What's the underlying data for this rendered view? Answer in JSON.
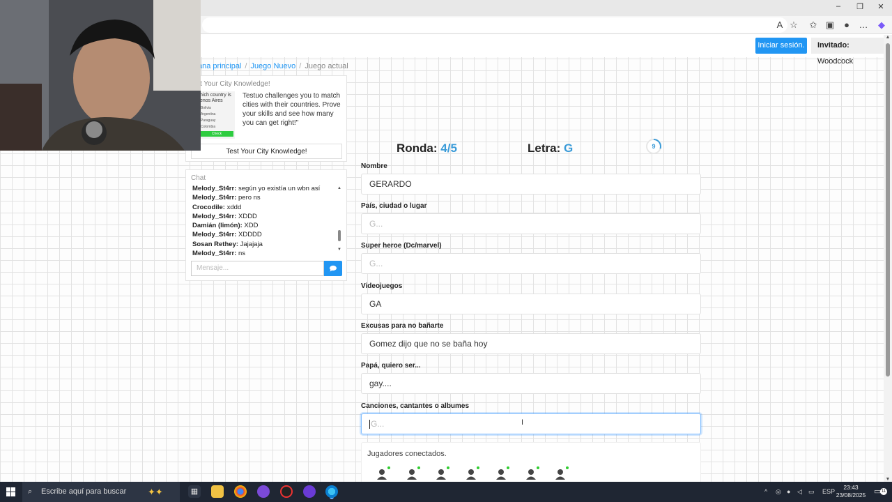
{
  "browser": {
    "window_buttons": {
      "minimize": "–",
      "restore": "❐",
      "close": "✕"
    },
    "toolbar_icons": [
      "read-aloud-icon",
      "favorite-star-icon",
      "favorites-icon",
      "collections-icon",
      "profile-icon",
      "more-icon",
      "copilot-icon"
    ]
  },
  "header": {
    "login_label": "Iniciar sesión.",
    "guest_prefix": "Invitado:",
    "guest_name": "Woodcock"
  },
  "breadcrumb": {
    "home": "ana principal",
    "new_game": "Juego Nuevo",
    "current": "Juego actual",
    "separator": "/"
  },
  "ad": {
    "title": "t Your City Knowledge!",
    "image_question": "hich country is enos Aires",
    "image_options": [
      "Bolivia",
      "Argentina",
      "Paraguay",
      "Colombia"
    ],
    "image_button": "Check",
    "text": "Testuo challenges you to match cities with their countries. Prove your skills and see how many you can get right!\"",
    "button": "Test Your City Knowledge!"
  },
  "chat": {
    "title": "Chat",
    "messages": [
      {
        "user": "Melody_St4rr:",
        "text": "según yo existía un wbn así"
      },
      {
        "user": "Melody_St4rr:",
        "text": "pero ns"
      },
      {
        "user": "Crocodile:",
        "text": "xddd"
      },
      {
        "user": "Melody_St4rr:",
        "text": "XDDD"
      },
      {
        "user": "Damián (limón):",
        "text": "XDD"
      },
      {
        "user": "Melody_St4rr:",
        "text": "XDDDD"
      },
      {
        "user": "Sosan Rethey:",
        "text": "Jajajaja"
      },
      {
        "user": "Melody_St4rr:",
        "text": "ns"
      }
    ],
    "input_placeholder": "Mensaje...",
    "scroll_position": 0.9
  },
  "game": {
    "round_label": "Ronda:",
    "round_value": "4/5",
    "letter_label": "Letra:",
    "letter_value": "G",
    "timer_value": "9",
    "timer_fraction": 0.3
  },
  "fields": [
    {
      "label": "Nombre",
      "value": "GERARDO",
      "placeholder": ""
    },
    {
      "label": "País, ciudad o lugar",
      "value": "",
      "placeholder": "G..."
    },
    {
      "label": "Super heroe (Dc/marvel)",
      "value": "",
      "placeholder": "G..."
    },
    {
      "label": "Videojuegos",
      "value": "GA",
      "placeholder": ""
    },
    {
      "label": "Excusas para no bañarte",
      "value": "Gomez dijo que no se baña hoy",
      "placeholder": ""
    },
    {
      "label": "Papá, quiero ser...",
      "value": "gay....",
      "placeholder": ""
    },
    {
      "label": "Canciones, cantantes o albumes",
      "value": "",
      "placeholder": "G..."
    }
  ],
  "players": {
    "title": "Jugadores conectados.",
    "count": 7
  },
  "taskbar": {
    "search_placeholder": "Escribe aquí para buscar",
    "language": "ESP",
    "time": "23:43",
    "date": "23/08/2025",
    "notification_count": "11"
  },
  "colors": {
    "accent": "#2196f3",
    "round_accent": "#3a9bd8",
    "online": "#33cc33"
  }
}
